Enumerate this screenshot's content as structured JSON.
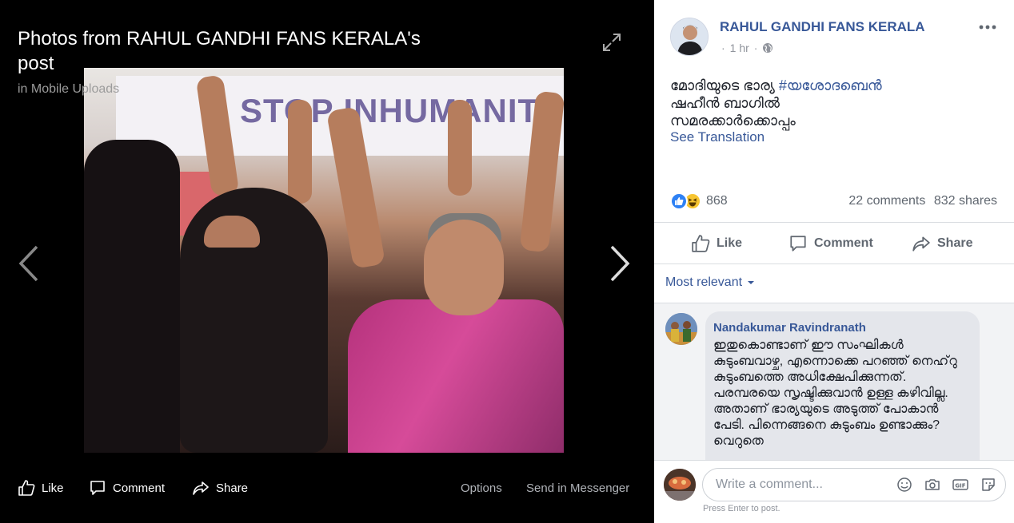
{
  "viewer": {
    "title": "Photos from RAHUL GANDHI FANS KERALA's post",
    "album": "in Mobile Uploads",
    "banner_text": "STOP INHUMANITY",
    "actions": {
      "like": "Like",
      "comment": "Comment",
      "share": "Share",
      "options": "Options",
      "send": "Send in Messenger"
    }
  },
  "post": {
    "page_name": "RAHUL GANDHI FANS KERALA",
    "time": "1 hr",
    "privacy_icon": "globe-icon",
    "line1": "മോദിയുടെ ഭാര്യ ",
    "hashtag": "#യശോദബെൻ",
    "line2": "ഷഹീൻ ബാഗിൽ",
    "line3": "സമരക്കാർക്കൊപ്പം",
    "see_translation": "See Translation",
    "reaction_count": "868",
    "comments_count": "22 comments",
    "shares_count": "832 shares",
    "actions": {
      "like": "Like",
      "comment": "Comment",
      "share": "Share"
    }
  },
  "comments": {
    "sort_label": "Most relevant",
    "items": [
      {
        "author": "Nandakumar Ravindranath",
        "text": "ഇതുകൊണ്ടാണ് ഈ സംഘികൾ കുടുംബവാഴ്ച, എന്നൊക്കെ പറഞ്ഞ് നെഹ്‌റു കുടുംബത്തെ അധിക്ഷേപിക്കുന്നത്. പരമ്പരയെ സൃഷ്ടിക്കുവാൻ ഉള്ള കഴിവില്ല. അതാണ് ഭാര്യയുടെ അടുത്ത് പോകാൻ പേടി. പിന്നെങ്ങനെ കുടുംബം ഉണ്ടാക്കും? വെറുതെ"
      }
    ],
    "write_placeholder": "Write a comment...",
    "press_enter": "Press Enter to post."
  },
  "colors": {
    "link_blue": "#385898",
    "like_blue": "#2e81f4",
    "haha_yellow": "#f7c531"
  }
}
